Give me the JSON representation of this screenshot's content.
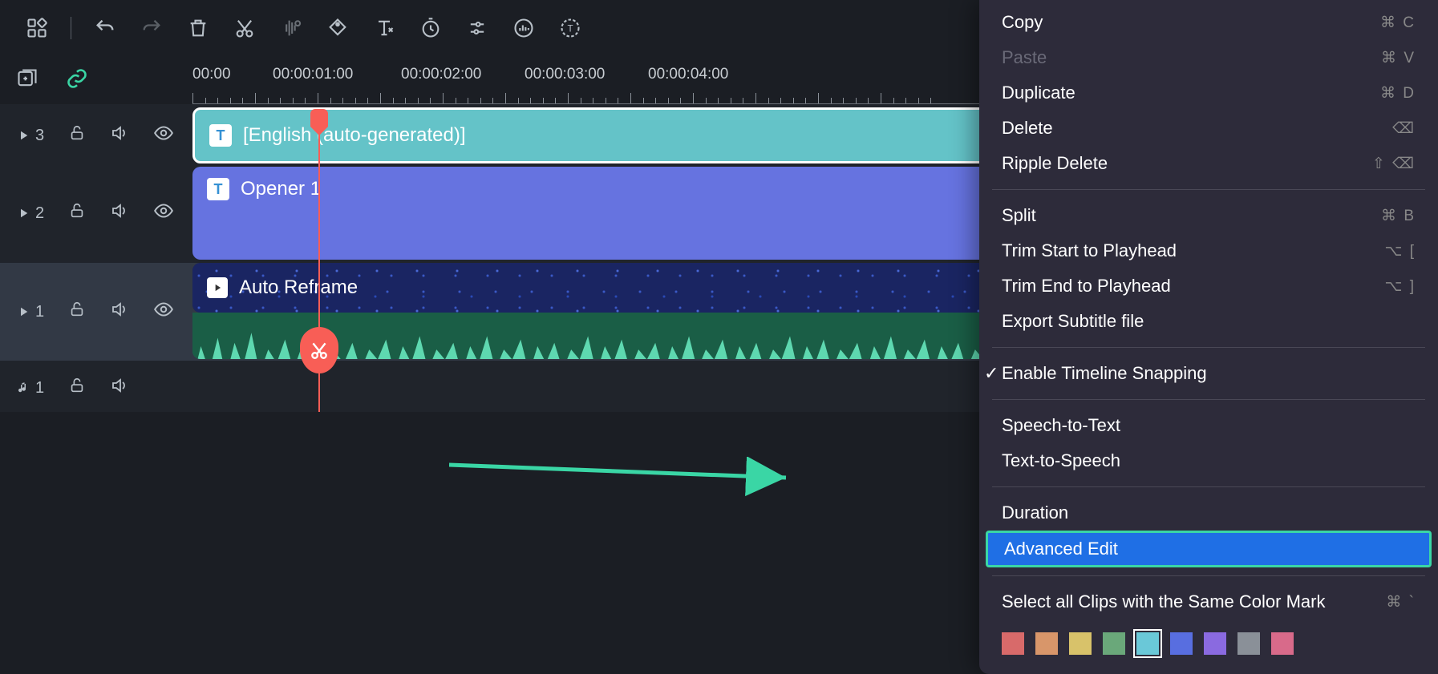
{
  "toolbar": {
    "icons": [
      "apps",
      "undo",
      "redo",
      "delete",
      "cut",
      "mute",
      "tag",
      "text",
      "timer",
      "adjust",
      "audio-meter",
      "caption-timer"
    ]
  },
  "ruler": {
    "labels": [
      "00:00",
      "00:00:01:00",
      "00:00:02:00",
      "00:00:03:00",
      "00:00:04:00"
    ]
  },
  "tracks": {
    "caption": {
      "number": "3",
      "clip_label": "[English (auto-generated)]"
    },
    "title": {
      "number": "2",
      "clip_label": "Opener 1"
    },
    "video": {
      "number": "1",
      "clip_label": "Auto Reframe"
    },
    "audio": {
      "number": "1"
    }
  },
  "menu": {
    "items": [
      {
        "label": "Copy",
        "shortcut": "⌘ C"
      },
      {
        "label": "Paste",
        "shortcut": "⌘ V",
        "disabled": true
      },
      {
        "label": "Duplicate",
        "shortcut": "⌘ D"
      },
      {
        "label": "Delete",
        "shortcut": "⌫"
      },
      {
        "label": "Ripple Delete",
        "shortcut": "⇧ ⌫"
      },
      {
        "divider": true
      },
      {
        "label": "Split",
        "shortcut": "⌘ B"
      },
      {
        "label": "Trim Start to Playhead",
        "shortcut": "⌥ ["
      },
      {
        "label": "Trim End to Playhead",
        "shortcut": "⌥ ]"
      },
      {
        "label": "Export Subtitle file"
      },
      {
        "divider": true
      },
      {
        "label": "Enable Timeline Snapping",
        "checked": true
      },
      {
        "divider": true
      },
      {
        "label": "Speech-to-Text"
      },
      {
        "label": "Text-to-Speech"
      },
      {
        "divider": true
      },
      {
        "label": "Duration"
      },
      {
        "label": "Advanced Edit",
        "highlighted": true
      },
      {
        "divider": true
      },
      {
        "label": "Select all Clips with the Same Color Mark",
        "shortcut": "⌘ `"
      }
    ],
    "colors": [
      "#d86a6a",
      "#d8966a",
      "#d8c26a",
      "#6aa87a",
      "#6ac8d8",
      "#586ee0",
      "#8a6ae0",
      "#8a9098",
      "#d86a8a"
    ]
  }
}
